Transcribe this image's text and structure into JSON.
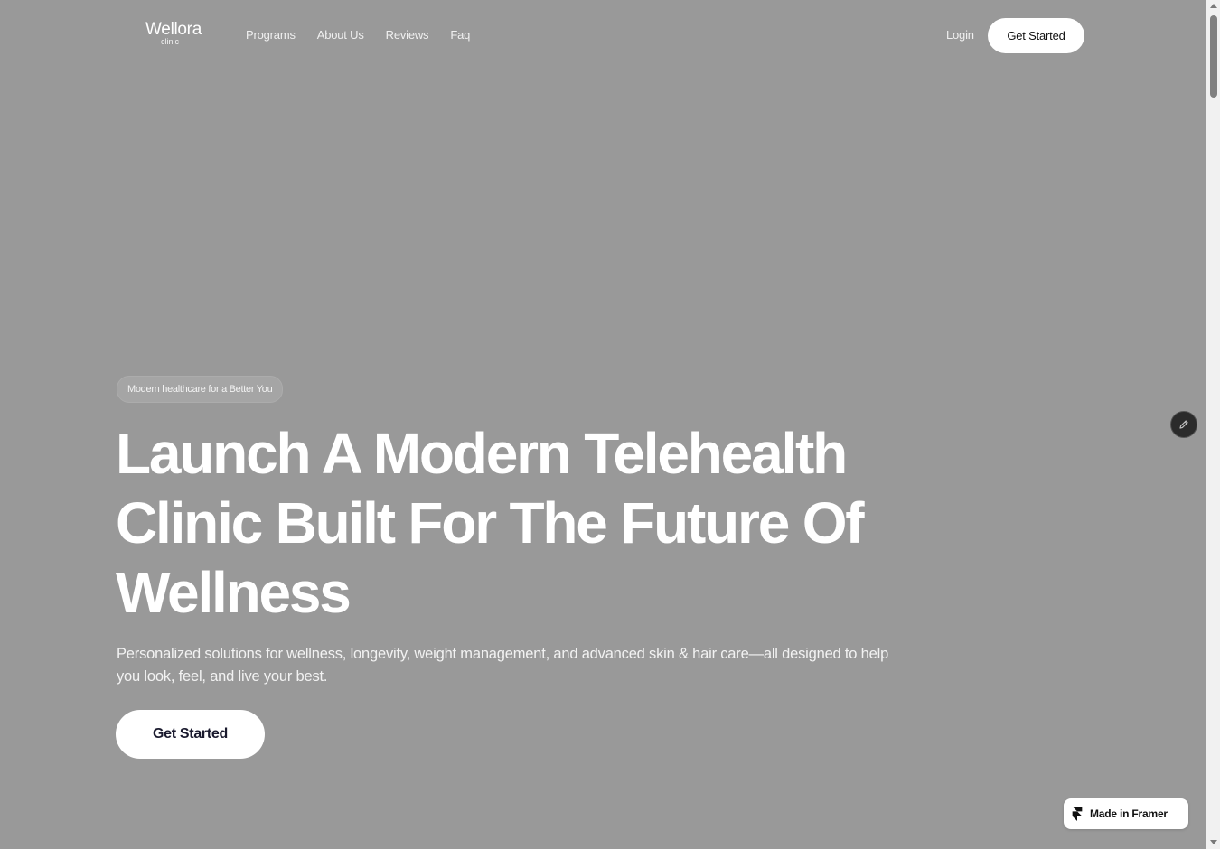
{
  "brand": {
    "name": "Wellora",
    "sub": "clinic"
  },
  "nav": {
    "items": [
      {
        "label": "Programs"
      },
      {
        "label": "About Us"
      },
      {
        "label": "Reviews"
      },
      {
        "label": "Faq"
      }
    ],
    "login_label": "Login",
    "cta_label": "Get Started"
  },
  "hero": {
    "pill": "Modern healthcare for a Better You",
    "headline": "Launch A Modern Telehealth Clinic Built For The Future Of Wellness",
    "subtext": "Personalized solutions for wellness, longevity, weight management, and advanced skin & hair care—all designed to help you look, feel, and live your best.",
    "cta_label": "Get Started"
  },
  "badge": {
    "label": "Made in Framer",
    "icon": "framer-logo-icon"
  },
  "edit_button": {
    "icon": "pencil-icon"
  },
  "colors": {
    "background": "#999999",
    "button_bg": "#ffffff",
    "button_text": "#1a1a2e"
  }
}
